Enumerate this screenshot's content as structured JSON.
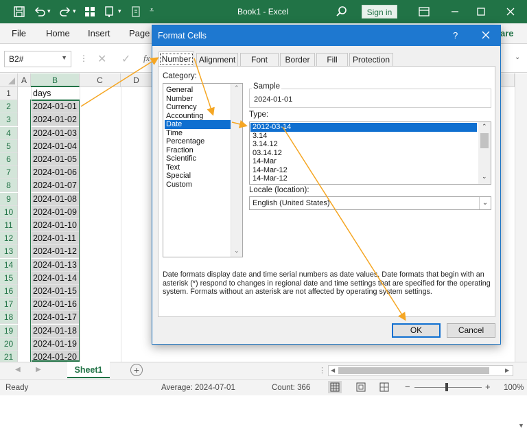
{
  "app": {
    "doc_title": "Book1 - Excel",
    "sign_in": "Sign in",
    "share": "are"
  },
  "ribbon": {
    "tabs": [
      "File",
      "Home",
      "Insert",
      "Page"
    ]
  },
  "formula_bar": {
    "name_box": "B2#"
  },
  "sheet": {
    "columns": [
      "A",
      "B",
      "C",
      "D"
    ],
    "right_columns": [
      "",
      "",
      ""
    ],
    "rows": [
      "1",
      "2",
      "3",
      "4",
      "5",
      "6",
      "7",
      "8",
      "9",
      "10",
      "11",
      "12",
      "13",
      "14",
      "15",
      "16",
      "17",
      "18",
      "19",
      "20",
      "21"
    ],
    "b_values": [
      "days",
      "2024-01-01",
      "2024-01-02",
      "2024-01-03",
      "2024-01-04",
      "2024-01-05",
      "2024-01-06",
      "2024-01-07",
      "2024-01-08",
      "2024-01-09",
      "2024-01-10",
      "2024-01-11",
      "2024-01-12",
      "2024-01-13",
      "2024-01-14",
      "2024-01-15",
      "2024-01-16",
      "2024-01-17",
      "2024-01-18",
      "2024-01-19",
      "2024-01-20"
    ],
    "tab_name": "Sheet1"
  },
  "status": {
    "ready": "Ready",
    "average": "Average: 2024-07-01",
    "count": "Count: 366",
    "zoom": "100%"
  },
  "dialog": {
    "title": "Format Cells",
    "help": "?",
    "tabs": [
      "Number",
      "Alignment",
      "Font",
      "Border",
      "Fill",
      "Protection"
    ],
    "category_label": "Category:",
    "categories": [
      "General",
      "Number",
      "Currency",
      "Accounting",
      "Date",
      "Time",
      "Percentage",
      "Fraction",
      "Scientific",
      "Text",
      "Special",
      "Custom"
    ],
    "selected_category_index": 4,
    "sample_label": "Sample",
    "sample_value": "2024-01-01",
    "type_label": "Type:",
    "types": [
      "2012-03-14",
      "3.14",
      "3.14.12",
      "03.14.12",
      "14-Mar",
      "14-Mar-12",
      "14-Mar-12"
    ],
    "selected_type_index": 0,
    "locale_label": "Locale (location):",
    "locale_value": "English (United States)",
    "description": "Date formats display date and time serial numbers as date values.  Date formats that begin with an asterisk (*) respond to changes in regional date and time settings that are specified for the operating system. Formats without an asterisk are not affected by operating system settings.",
    "ok": "OK",
    "cancel": "Cancel"
  },
  "colors": {
    "excel_green": "#217346",
    "dialog_blue": "#1e78d0",
    "selection_blue": "#0f6fd0",
    "annotation_orange": "#f5a623"
  }
}
